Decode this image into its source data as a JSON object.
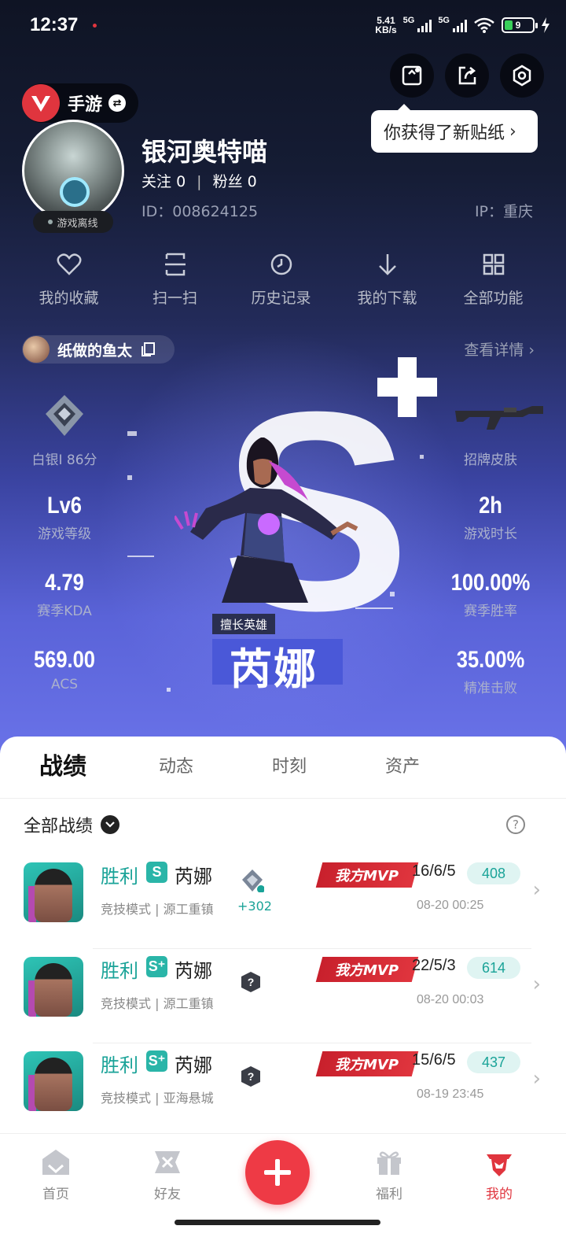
{
  "status": {
    "time": "12:37",
    "speed_top": "5.41",
    "speed_bottom": "KB/s",
    "net1": "5G",
    "net2": "5G",
    "battery": "9"
  },
  "tooltip": {
    "text": "你获得了新贴纸"
  },
  "game": {
    "label": "手游"
  },
  "profile": {
    "username": "银河奥特喵",
    "follow_label": "关注",
    "follow_count": "0",
    "fans_label": "粉丝",
    "fans_count": "0",
    "id_text": "ID：008624125",
    "ip_text": "IP：重庆",
    "status": "游戏离线"
  },
  "actions": [
    {
      "label": "我的收藏",
      "icon": "heart-icon"
    },
    {
      "label": "扫一扫",
      "icon": "scan-icon"
    },
    {
      "label": "历史记录",
      "icon": "history-icon"
    },
    {
      "label": "我的下载",
      "icon": "download-icon"
    },
    {
      "label": "全部功能",
      "icon": "grid-icon"
    }
  ],
  "account": {
    "name": "纸做的鱼太",
    "details": "查看详情"
  },
  "stats": {
    "rank": {
      "value": "",
      "label": "白银I 86分"
    },
    "skin": {
      "label": "招牌皮肤"
    },
    "level": {
      "value": "Lv6",
      "label": "游戏等级"
    },
    "hours": {
      "value": "2h",
      "label": "游戏时长"
    },
    "kda": {
      "value": "4.79",
      "label": "赛季KDA"
    },
    "winrate": {
      "value": "100.00%",
      "label": "赛季胜率"
    },
    "acs": {
      "value": "569.00",
      "label": "ACS"
    },
    "precision": {
      "value": "35.00%",
      "label": "精准击败"
    }
  },
  "hero": {
    "tag": "擅长英雄",
    "name": "芮娜",
    "grade": "S"
  },
  "tabs": [
    "战绩",
    "动态",
    "时刻",
    "资产"
  ],
  "filter": {
    "label": "全部战绩"
  },
  "matches": [
    {
      "result": "胜利",
      "mode": "S",
      "hero": "芮娜",
      "sub": "竞技模式 | 源工重镇",
      "delta": "+302",
      "mvp": "我方MVP",
      "kda": "16/6/5",
      "score": "408",
      "time": "08-20 00:25"
    },
    {
      "result": "胜利",
      "mode": "S⁺",
      "hero": "芮娜",
      "sub": "竞技模式 | 源工重镇",
      "delta": "",
      "mvp": "我方MVP",
      "kda": "22/5/3",
      "score": "614",
      "time": "08-20 00:03"
    },
    {
      "result": "胜利",
      "mode": "S⁺",
      "hero": "芮娜",
      "sub": "竞技模式 | 亚海悬城",
      "delta": "",
      "mvp": "我方MVP",
      "kda": "15/6/5",
      "score": "437",
      "time": "08-19 23:45"
    }
  ],
  "nav": [
    {
      "label": "首页"
    },
    {
      "label": "好友"
    },
    {
      "label": "福利"
    },
    {
      "label": "我的"
    }
  ],
  "colors": {
    "accent": "#e0353e",
    "teal": "#1aa398",
    "hero_blue": "#4a58d8"
  }
}
